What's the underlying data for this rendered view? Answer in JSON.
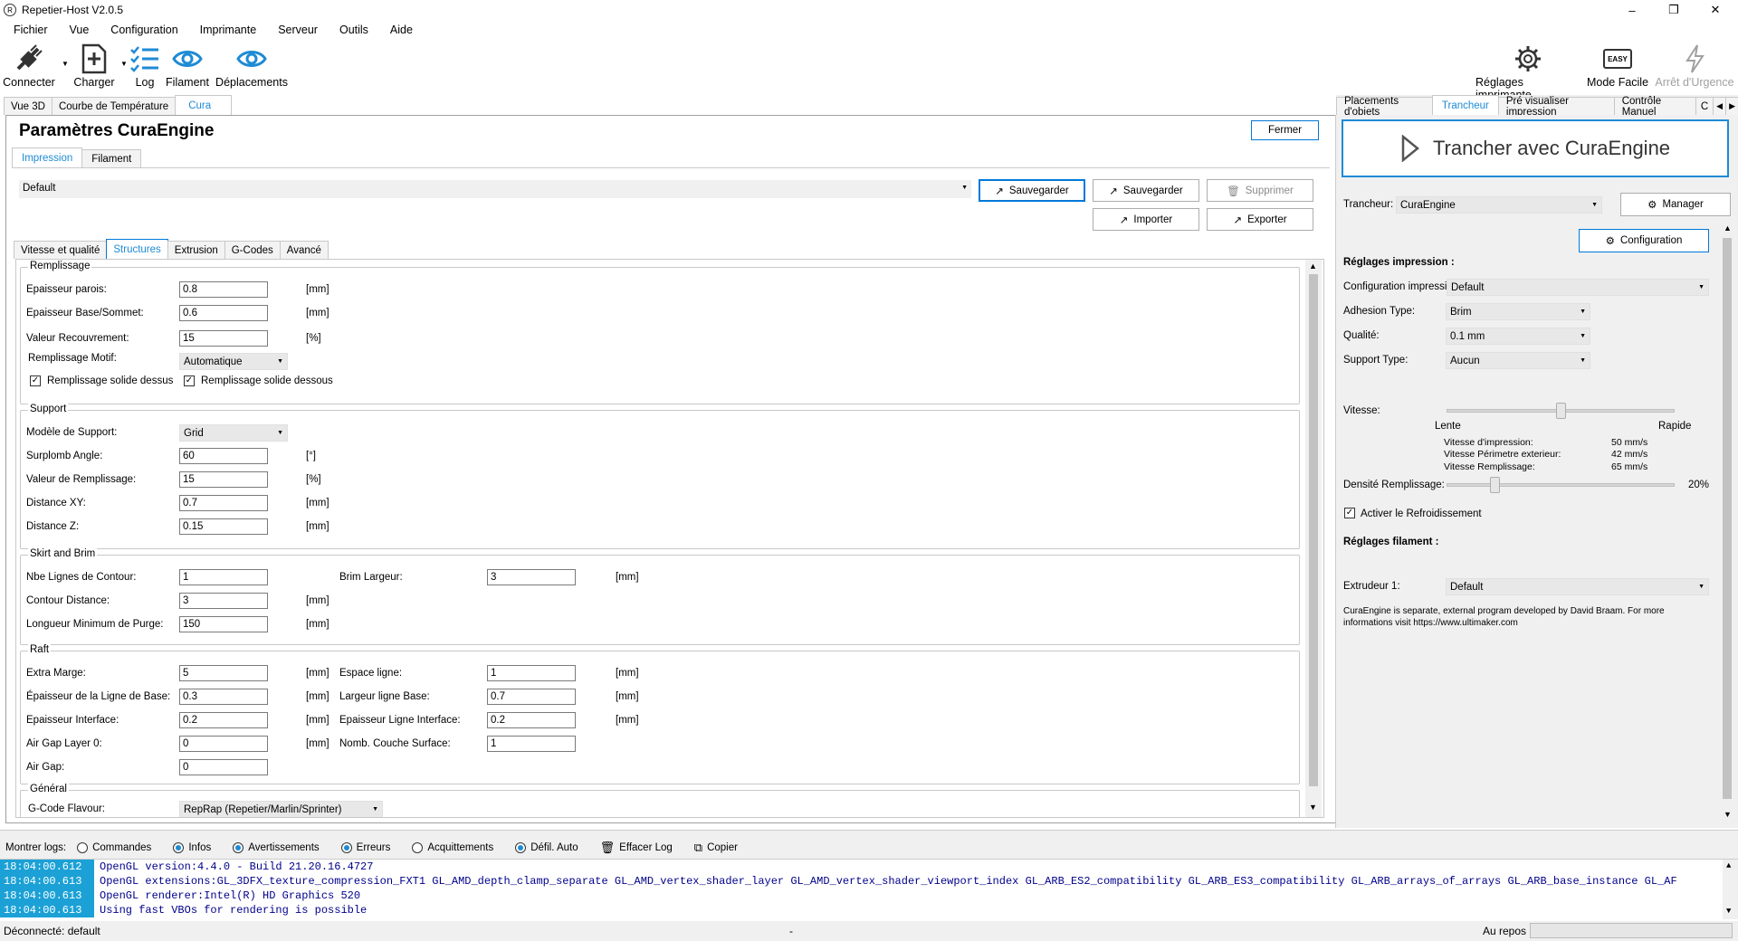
{
  "window": {
    "title": "Repetier-Host V2.0.5",
    "icon": "repetier-logo-icon"
  },
  "menu": [
    "Fichier",
    "Vue",
    "Configuration",
    "Imprimante",
    "Serveur",
    "Outils",
    "Aide"
  ],
  "toolbar": {
    "connect": "Connecter",
    "load": "Charger",
    "log": "Log",
    "filament": "Filament",
    "moves": "Déplacements",
    "printer_settings": "Réglages imprimante",
    "easy_mode": "Mode Facile",
    "easy_badge": "EASY",
    "emergency": "Arrêt d'Urgence"
  },
  "left_tabs": [
    "Vue 3D",
    "Courbe de Température",
    "Cura"
  ],
  "cura": {
    "title": "Paramètres CuraEngine",
    "close": "Fermer",
    "subtabs": [
      "Impression",
      "Filament"
    ],
    "profile": "Default",
    "buttons": {
      "save1": "Sauvegarder",
      "save2": "Sauvegarder",
      "delete": "Supprimer",
      "import": "Importer",
      "export": "Exporter"
    },
    "section_tabs": [
      "Vitesse et qualité",
      "Structures",
      "Extrusion",
      "G-Codes",
      "Avancé"
    ],
    "remplissage": {
      "title": "Remplissage",
      "wall_label": "Epaisseur parois:",
      "wall": "0.8",
      "wall_unit": "[mm]",
      "base_label": "Epaisseur Base/Sommet:",
      "base": "0.6",
      "base_unit": "[mm]",
      "overlap_label": "Valeur Recouvrement:",
      "overlap": "15",
      "overlap_unit": "[%]",
      "pattern_label": "Remplissage Motif:",
      "pattern": "Automatique",
      "solid_top": "Remplissage solide dessus",
      "solid_bottom": "Remplissage solide dessous"
    },
    "support": {
      "title": "Support",
      "model_label": "Modèle de Support:",
      "model": "Grid",
      "angle_label": "Surplomb Angle:",
      "angle": "60",
      "angle_unit": "[°]",
      "fill_label": "Valeur de Remplissage:",
      "fill": "15",
      "fill_unit": "[%]",
      "xy_label": "Distance XY:",
      "xy": "0.7",
      "xy_unit": "[mm]",
      "z_label": "Distance Z:",
      "z": "0.15",
      "z_unit": "[mm]"
    },
    "skirt": {
      "title": "Skirt and Brim",
      "lines_label": "Nbe Lignes de Contour:",
      "lines": "1",
      "brim_label": "Brim Largeur:",
      "brim": "3",
      "brim_unit": "[mm]",
      "dist_label": "Contour Distance:",
      "dist": "3",
      "dist_unit": "[mm]",
      "purge_label": "Longueur Minimum de Purge:",
      "purge": "150",
      "purge_unit": "[mm]"
    },
    "raft": {
      "title": "Raft",
      "margin_label": "Extra Marge:",
      "margin": "5",
      "margin_unit": "[mm]",
      "space_label": "Espace ligne:",
      "space": "1",
      "space_unit": "[mm]",
      "baseline_label": "Épaisseur de la Ligne de Base:",
      "baseline": "0.3",
      "baseline_unit": "[mm]",
      "basewidth_label": "Largeur ligne Base:",
      "basewidth": "0.7",
      "basewidth_unit": "[mm]",
      "iface_label": "Epaisseur Interface:",
      "iface": "0.2",
      "iface_unit": "[mm]",
      "ifaceline_label": "Epaisseur Ligne Interface:",
      "ifaceline": "0.2",
      "ifaceline_unit": "[mm]",
      "gap0_label": "Air Gap Layer 0:",
      "gap0": "0",
      "gap0_unit": "[mm]",
      "surface_label": "Nomb. Couche Surface:",
      "surface": "1",
      "gap_label": "Air Gap:",
      "gap": "0"
    },
    "general": {
      "title": "Général",
      "flavour_label": "G-Code Flavour:",
      "flavour": "RepRap (Repetier/Marlin/Sprinter)"
    }
  },
  "right_tabs": [
    "Placements d'objets",
    "Trancheur",
    "Pré visualiser impression",
    "Contrôle Manuel",
    "C"
  ],
  "slicer": {
    "slice_btn": "Trancher avec CuraEngine",
    "slicer_label": "Trancheur:",
    "slicer": "CuraEngine",
    "manager": "Manager",
    "configuration": "Configuration",
    "print_settings": "Réglages impression :",
    "print_config_label": "Configuration impression:",
    "print_config": "Default",
    "adhesion_label": "Adhesion Type:",
    "adhesion": "Brim",
    "quality_label": "Qualité:",
    "quality": "0.1 mm",
    "support_label": "Support Type:",
    "support": "Aucun",
    "speed_label": "Vitesse:",
    "slow": "Lente",
    "fast": "Rapide",
    "speed_fraction": 0.5,
    "print_speed_label": "Vitesse d'impression:",
    "print_speed": "50 mm/s",
    "perimeter_label": "Vitesse Périmetre exterieur:",
    "perimeter": "42 mm/s",
    "infill_speed_label": "Vitesse Remplissage:",
    "infill_speed": "65 mm/s",
    "density_label": "Densité Remplissage:",
    "density": "20%",
    "density_fraction": 0.2,
    "cooling": "Activer le Refroidissement",
    "filament_settings": "Réglages filament :",
    "extruder_label": "Extrudeur 1:",
    "extruder": "Default",
    "note": "CuraEngine is separate, external program developed by David Braam. For more informations visit https://www.ultimaker.com"
  },
  "logbar": {
    "show": "Montrer logs:",
    "commands": "Commandes",
    "infos": "Infos",
    "warnings": "Avertissements",
    "errors": "Erreurs",
    "acks": "Acquittements",
    "autoscroll": "Défil. Auto",
    "clear": "Effacer Log",
    "copy": "Copier"
  },
  "logs": [
    {
      "ts": "18:04:00.612",
      "msg": "OpenGL version:4.4.0 - Build 21.20.16.4727"
    },
    {
      "ts": "18:04:00.613",
      "msg": "OpenGL extensions:GL_3DFX_texture_compression_FXT1 GL_AMD_depth_clamp_separate GL_AMD_vertex_shader_layer GL_AMD_vertex_shader_viewport_index GL_ARB_ES2_compatibility GL_ARB_ES3_compatibility GL_ARB_arrays_of_arrays GL_ARB_base_instance GL_AF"
    },
    {
      "ts": "18:04:00.613",
      "msg": "OpenGL renderer:Intel(R) HD Graphics 520"
    },
    {
      "ts": "18:04:00.613",
      "msg": "Using fast VBOs for rendering is possible"
    }
  ],
  "status": {
    "left": "Déconnecté: default",
    "mid": "-",
    "right": "Au repos"
  },
  "colors": {
    "accent": "#1e8bd4",
    "log_ts_bg": "#1ba1d6",
    "log_text": "#00008b"
  }
}
